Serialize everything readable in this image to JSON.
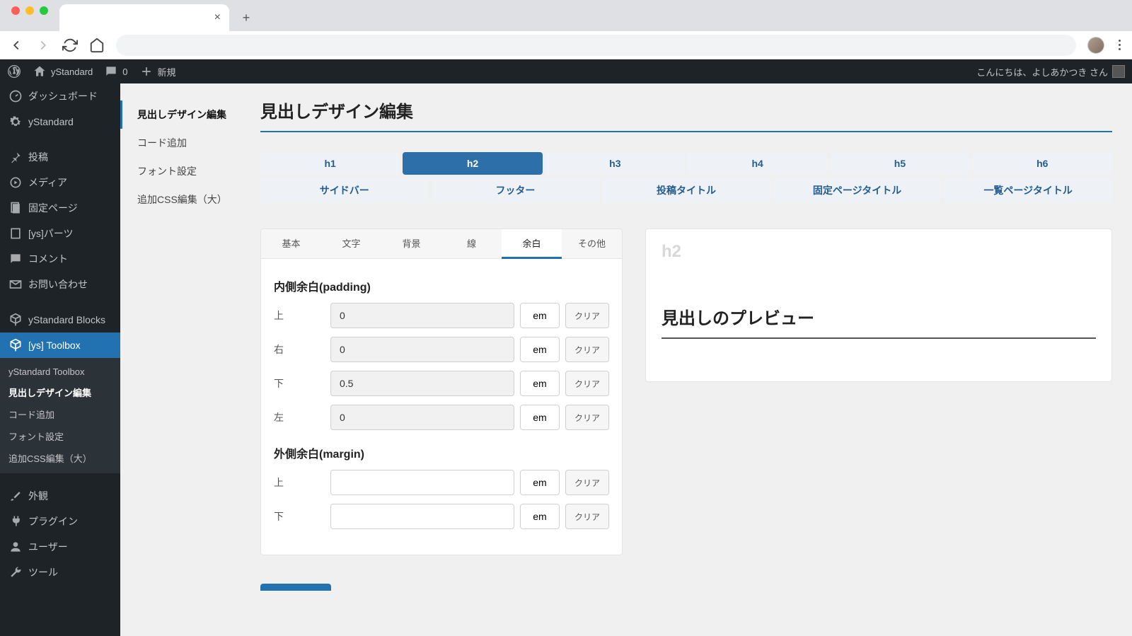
{
  "browser": {
    "new_tab": "+"
  },
  "admin_bar": {
    "site_name": "yStandard",
    "comments": "0",
    "new": "新規",
    "greeting": "こんにちは、よしあかつき さん"
  },
  "sidebar": {
    "items": [
      {
        "icon": "dashboard",
        "label": "ダッシュボード"
      },
      {
        "icon": "gear",
        "label": "yStandard"
      },
      {
        "icon": "pin",
        "label": "投稿"
      },
      {
        "icon": "media",
        "label": "メディア"
      },
      {
        "icon": "page",
        "label": "固定ページ"
      },
      {
        "icon": "parts",
        "label": "[ys]パーツ"
      },
      {
        "icon": "comment",
        "label": "コメント"
      },
      {
        "icon": "mail",
        "label": "お問い合わせ"
      },
      {
        "icon": "cube",
        "label": "yStandard Blocks"
      },
      {
        "icon": "cube",
        "label": "[ys] Toolbox"
      },
      {
        "icon": "brush",
        "label": "外観"
      },
      {
        "icon": "plug",
        "label": "プラグイン"
      },
      {
        "icon": "user",
        "label": "ユーザー"
      },
      {
        "icon": "wrench",
        "label": "ツール"
      }
    ],
    "submenu": [
      "yStandard Toolbox",
      "見出しデザイン編集",
      "コード追加",
      "フォント設定",
      "追加CSS編集（大）"
    ]
  },
  "inner_menu": [
    "見出しデザイン編集",
    "コード追加",
    "フォント設定",
    "追加CSS編集（大）"
  ],
  "page": {
    "title": "見出しデザイン編集"
  },
  "h_tabs_row1": [
    "h1",
    "h2",
    "h3",
    "h4",
    "h5",
    "h6"
  ],
  "h_tabs_row2": [
    "サイドバー",
    "フッター",
    "投稿タイトル",
    "固定ページタイトル",
    "一覧ページタイトル"
  ],
  "h_tab_active": "h2",
  "set_tabs": [
    "基本",
    "文字",
    "背景",
    "線",
    "余白",
    "その他"
  ],
  "set_tab_active": "余白",
  "panel": {
    "padding_title": "内側余白(padding)",
    "margin_title": "外側余白(margin)",
    "rows": {
      "padding": [
        {
          "label": "上",
          "value": "0"
        },
        {
          "label": "右",
          "value": "0"
        },
        {
          "label": "下",
          "value": "0.5"
        },
        {
          "label": "左",
          "value": "0"
        }
      ],
      "margin": [
        {
          "label": "上",
          "value": ""
        },
        {
          "label": "下",
          "value": ""
        }
      ]
    },
    "unit": "em",
    "clear": "クリア"
  },
  "preview": {
    "tag": "h2",
    "text": "見出しのプレビュー"
  }
}
